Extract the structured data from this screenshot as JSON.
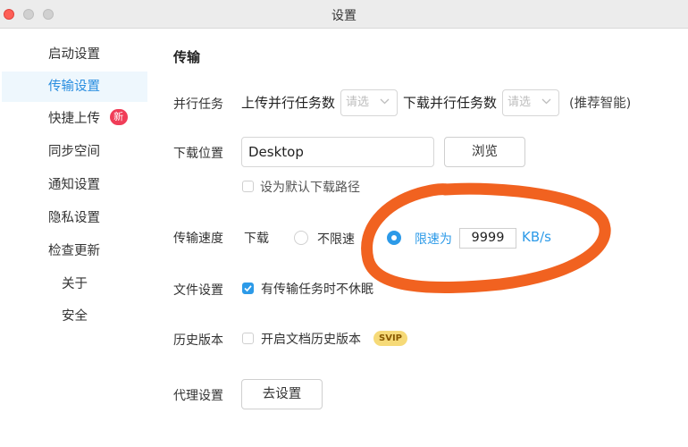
{
  "window": {
    "title": "设置"
  },
  "sidebar": {
    "items": [
      {
        "label": "启动设置"
      },
      {
        "label": "传输设置",
        "active": true
      },
      {
        "label": "快捷上传",
        "badge": "新"
      },
      {
        "label": "同步空间"
      },
      {
        "label": "通知设置"
      },
      {
        "label": "隐私设置"
      },
      {
        "label": "检查更新"
      },
      {
        "label": "关于"
      },
      {
        "label": "安全"
      }
    ]
  },
  "main": {
    "section_title": "传输",
    "parallel": {
      "label": "并行任务",
      "upload_label": "上传并行任务数",
      "upload_select": "请选",
      "download_label": "下载并行任务数",
      "download_select": "请选",
      "hint": "(推荐智能)"
    },
    "download_location": {
      "label": "下载位置",
      "value": "Desktop",
      "browse_button": "浏览",
      "default_checkbox_label": "设为默认下载路径",
      "default_checked": false
    },
    "speed": {
      "label": "传输速度",
      "sub_label": "下载",
      "unlimited_label": "不限速",
      "limit_label": "限速为",
      "limit_value": "9999",
      "unit": "KB/s",
      "selected": "limit"
    },
    "file_settings": {
      "label": "文件设置",
      "checkbox_label": "有传输任务时不休眠",
      "checked": true
    },
    "history": {
      "label": "历史版本",
      "checkbox_label": "开启文档历史版本",
      "checked": false,
      "badge": "SVIP"
    },
    "proxy": {
      "label": "代理设置",
      "button": "去设置"
    }
  },
  "colors": {
    "accent": "#2c9ae8",
    "active_bg": "#eef7fd",
    "badge_new": "#f03d58",
    "svip_badge": "#f6da78",
    "annotation": "#f05a14"
  }
}
